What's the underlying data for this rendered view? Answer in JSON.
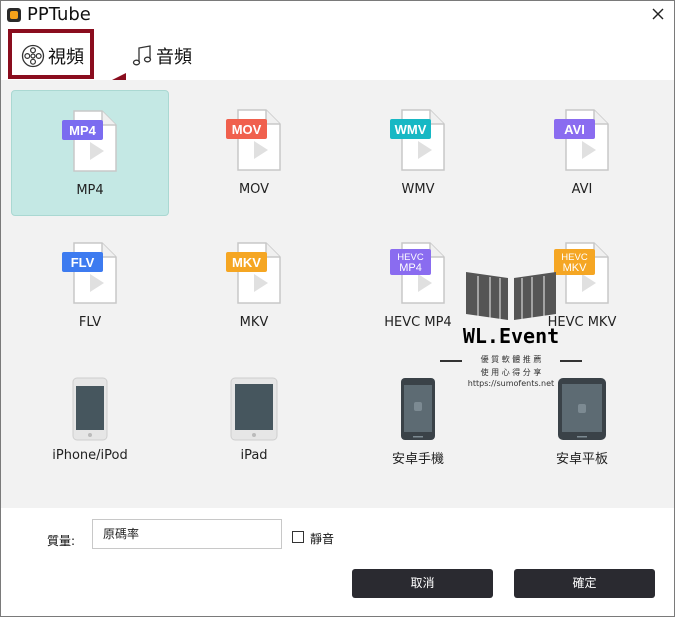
{
  "window": {
    "title": "PPTube"
  },
  "tabs": [
    {
      "label": "視頻",
      "icon": "film-reel-icon"
    },
    {
      "label": "音頻",
      "icon": "music-note-icon"
    }
  ],
  "formats": [
    {
      "label": "MP4",
      "badge": "MP4",
      "color": "#7b6cf0",
      "selected": true
    },
    {
      "label": "MOV",
      "badge": "MOV",
      "color": "#f0604d"
    },
    {
      "label": "WMV",
      "badge": "WMV",
      "color": "#17b8c4"
    },
    {
      "label": "AVI",
      "badge": "AVI",
      "color": "#8a6cf0"
    },
    {
      "label": "FLV",
      "badge": "FLV",
      "color": "#3d7bf0"
    },
    {
      "label": "MKV",
      "badge": "MKV",
      "color": "#f5a623"
    },
    {
      "label": "HEVC MP4",
      "badge_line1": "HEVC",
      "badge_line2": "MP4",
      "color": "#8a6cf0"
    },
    {
      "label": "HEVC MKV",
      "badge_line1": "HEVC",
      "badge_line2": "MKV",
      "color": "#f5a623"
    }
  ],
  "devices": [
    {
      "label": "iPhone/iPod",
      "icon": "iphone-icon"
    },
    {
      "label": "iPad",
      "icon": "ipad-icon"
    },
    {
      "label": "安卓手機",
      "icon": "android-phone-icon"
    },
    {
      "label": "安卓平板",
      "icon": "android-tablet-icon"
    }
  ],
  "watermark": {
    "title": "WL.Event",
    "line1": "優 質 軟 體 推 薦",
    "line2": "使 用 心 得 分 享",
    "url": "https://sumofents.net"
  },
  "quality": {
    "label": "質量:",
    "value": "原碼率"
  },
  "mute": {
    "label": "靜音",
    "checked": false
  },
  "buttons": {
    "cancel": "取消",
    "ok": "確定"
  },
  "colors": {
    "accent_selected": "#c4e8e4",
    "highlight": "#8a0d1e",
    "button_bg": "#2a2a30"
  }
}
